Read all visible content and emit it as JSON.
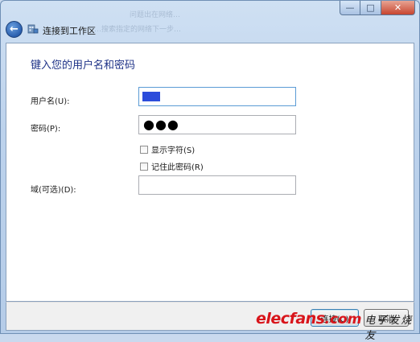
{
  "window": {
    "faded_background_text_1": "问题出在网络…",
    "faded_background_text_2": "…搜索指定的网络下一步…",
    "caption": {
      "minimize": "—",
      "maximize": "□",
      "close": "✕"
    }
  },
  "nav": {
    "title": "连接到工作区"
  },
  "form": {
    "heading": "键入您的用户名和密码",
    "username_label": "用户名(U):",
    "password_label": "密码(P):",
    "password_mask": "●●●",
    "show_chars_label": "显示字符(S)",
    "remember_label": "记住此密码(R)",
    "domain_label": "域(可选)(D):"
  },
  "footer": {
    "next_label": "连接(C)",
    "cancel_label": "取消"
  },
  "watermark": {
    "brand_latin": "elecfans",
    "brand_suffix": ".com",
    "brand_cn": "电子发烧友"
  },
  "colors": {
    "heading": "#1e3287",
    "selection": "#2c4cdb",
    "watermark_red": "#d8151b"
  }
}
